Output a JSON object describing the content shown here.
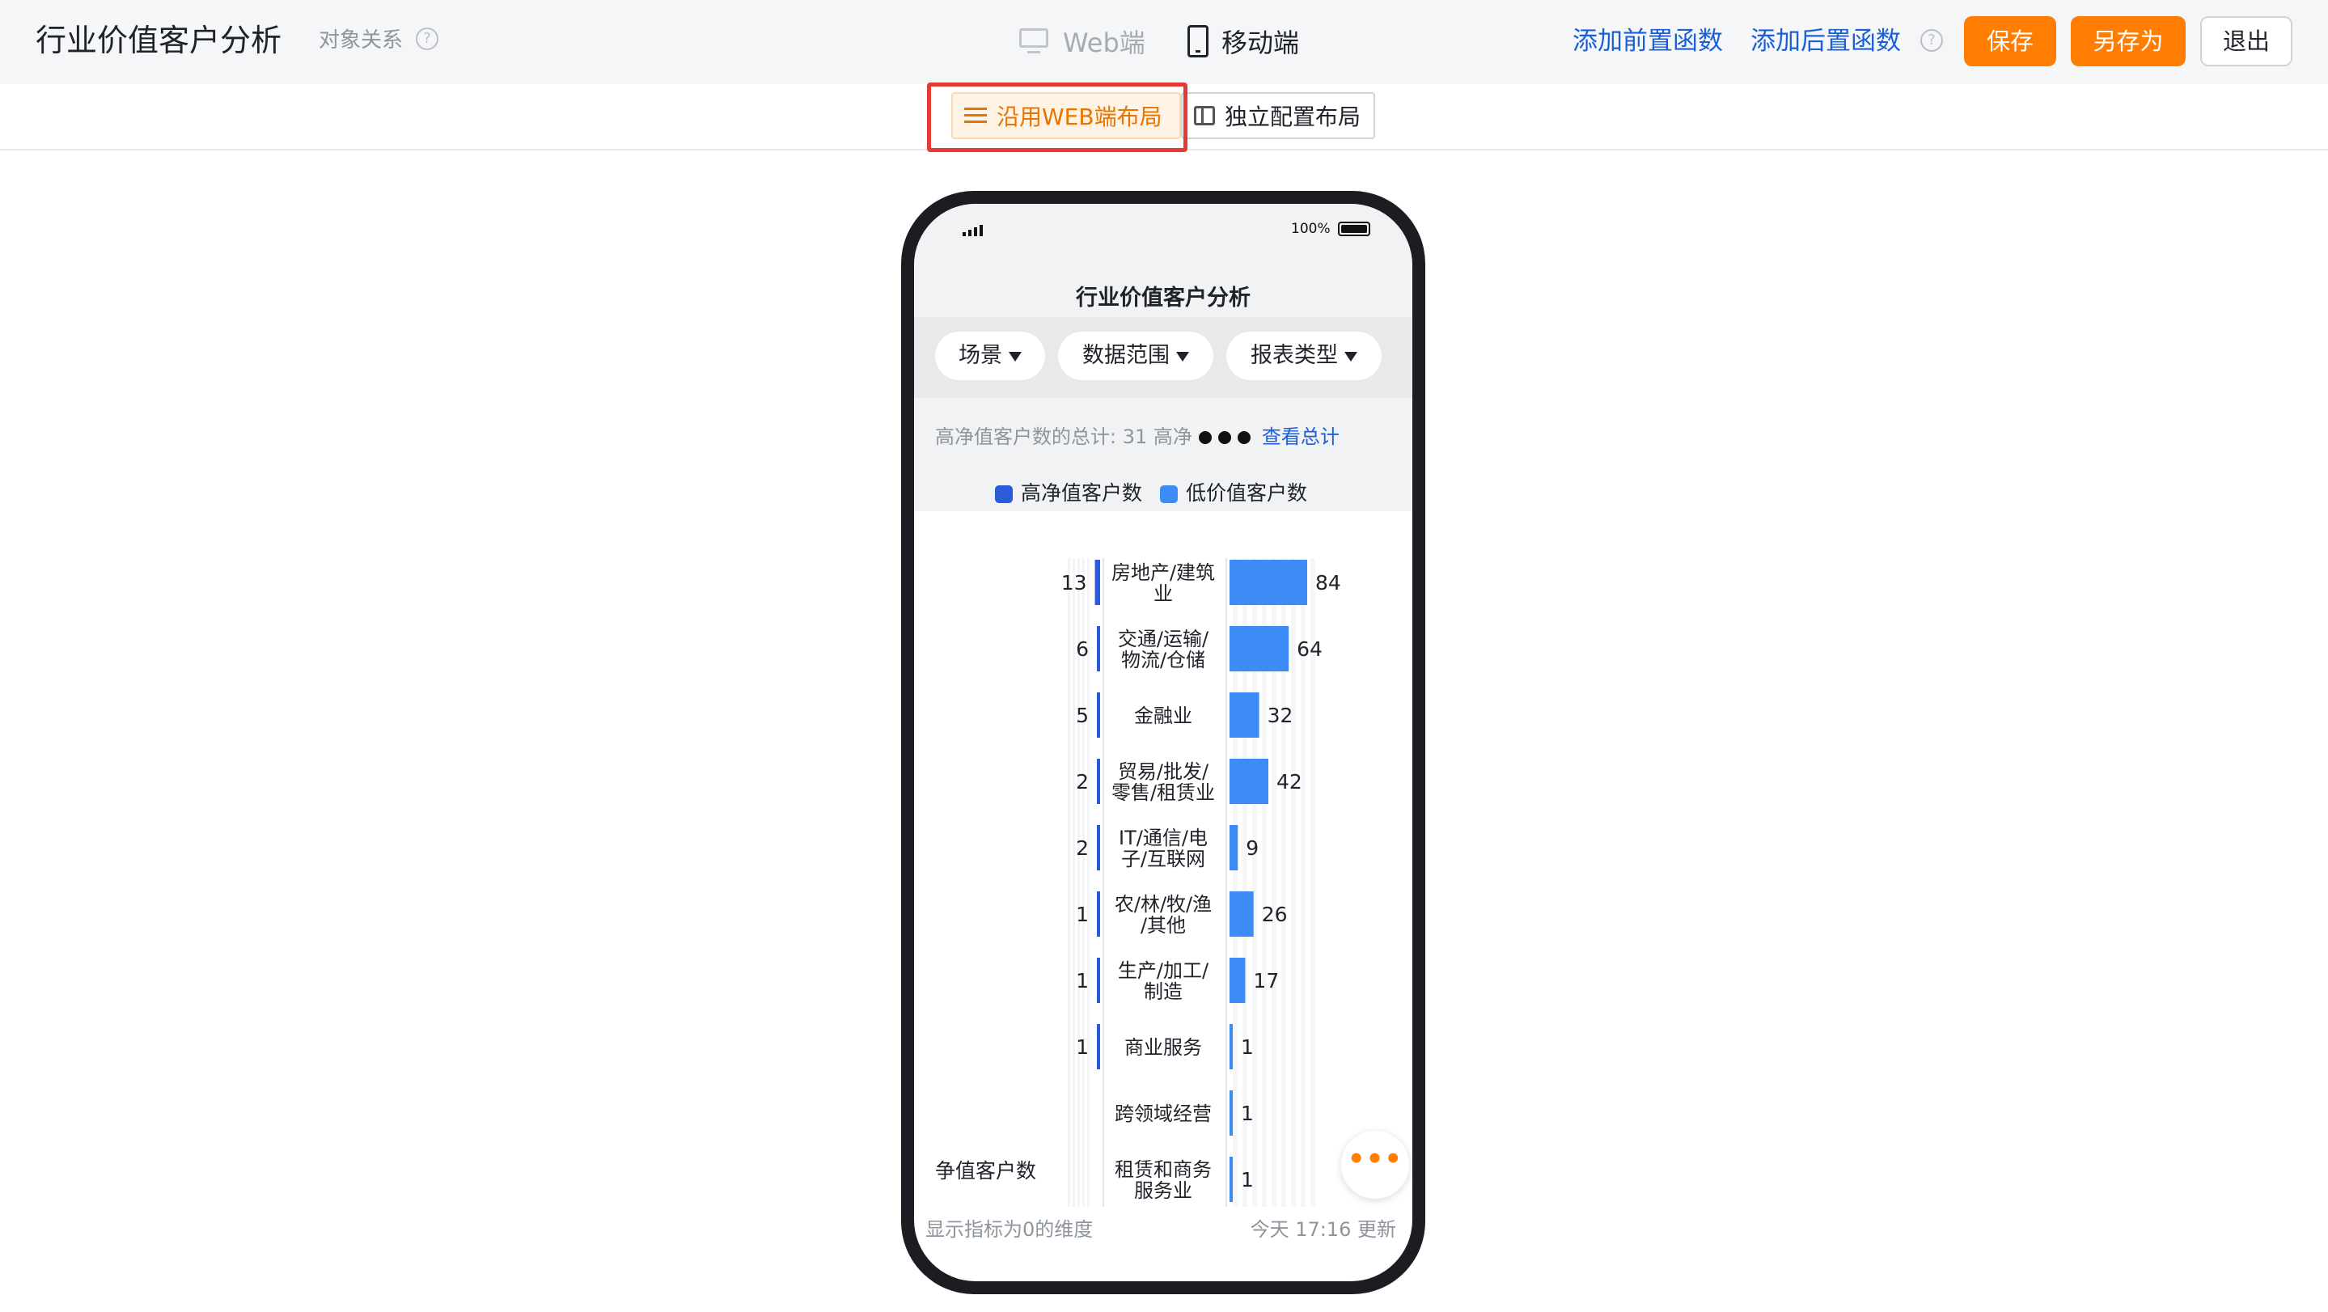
{
  "header": {
    "title": "行业价值客户分析",
    "subtitle": "对象关系",
    "tabs": [
      {
        "label": "Web端",
        "icon": "monitor-icon",
        "active": false
      },
      {
        "label": "移动端",
        "icon": "phone-icon",
        "active": true
      }
    ],
    "add_pre_function": "添加前置函数",
    "add_post_function": "添加后置函数",
    "save": "保存",
    "save_as": "另存为",
    "exit": "退出"
  },
  "layout_toggle": {
    "use_web_layout": "沿用WEB端布局",
    "independent_layout": "独立配置布局",
    "selected": "use_web_layout"
  },
  "phone": {
    "battery": "100%",
    "report_title": "行业价值客户分析",
    "filters": [
      "场景",
      "数据范围",
      "报表类型"
    ],
    "summary_text": "高净值客户数的总计: 31  高净",
    "summary_link": "查看总计",
    "bottom_label": "争值客户数",
    "footer_left": "显示指标为0的维度",
    "footer_right": "今天 17:16 更新",
    "more_icon": "•••"
  },
  "colors": {
    "accent": "#ff7d00",
    "link": "#1b5fd8",
    "series_high": "#2b5bd8",
    "series_low": "#3d8cf5"
  },
  "chart_data": {
    "type": "bar",
    "orientation": "horizontal-butterfly",
    "categories": [
      "房地产/建筑业",
      "交通/运输/物流/仓储",
      "金融业",
      "贸易/批发/零售/租赁业",
      "IT/通信/电子/互联网",
      "农/林/牧/渔/其他",
      "生产/加工/制造",
      "商业服务",
      "跨领域经营",
      "租赁和商务服务业"
    ],
    "category_lines": [
      [
        "房地产/建筑",
        "业"
      ],
      [
        "交通/运输/",
        "物流/仓储"
      ],
      [
        "金融业"
      ],
      [
        "贸易/批发/",
        "零售/租赁业"
      ],
      [
        "IT/通信/电",
        "子/互联网"
      ],
      [
        "农/林/牧/渔",
        "/其他"
      ],
      [
        "生产/加工/",
        "制造"
      ],
      [
        "商业服务"
      ],
      [
        "跨领域经营"
      ],
      [
        "租赁和商务",
        "服务业"
      ]
    ],
    "series": [
      {
        "name": "高净值客户数",
        "values": [
          13,
          6,
          5,
          2,
          2,
          1,
          1,
          1,
          0,
          0
        ]
      },
      {
        "name": "低价值客户数",
        "values": [
          84,
          64,
          32,
          42,
          9,
          26,
          17,
          1,
          1,
          1
        ]
      }
    ],
    "left_axis_max": 93,
    "right_axis_max": 84,
    "left_axis_ticks": [
      "93"
    ],
    "right_axis_ticks": [
      "20",
      "60"
    ],
    "legend": "top"
  }
}
